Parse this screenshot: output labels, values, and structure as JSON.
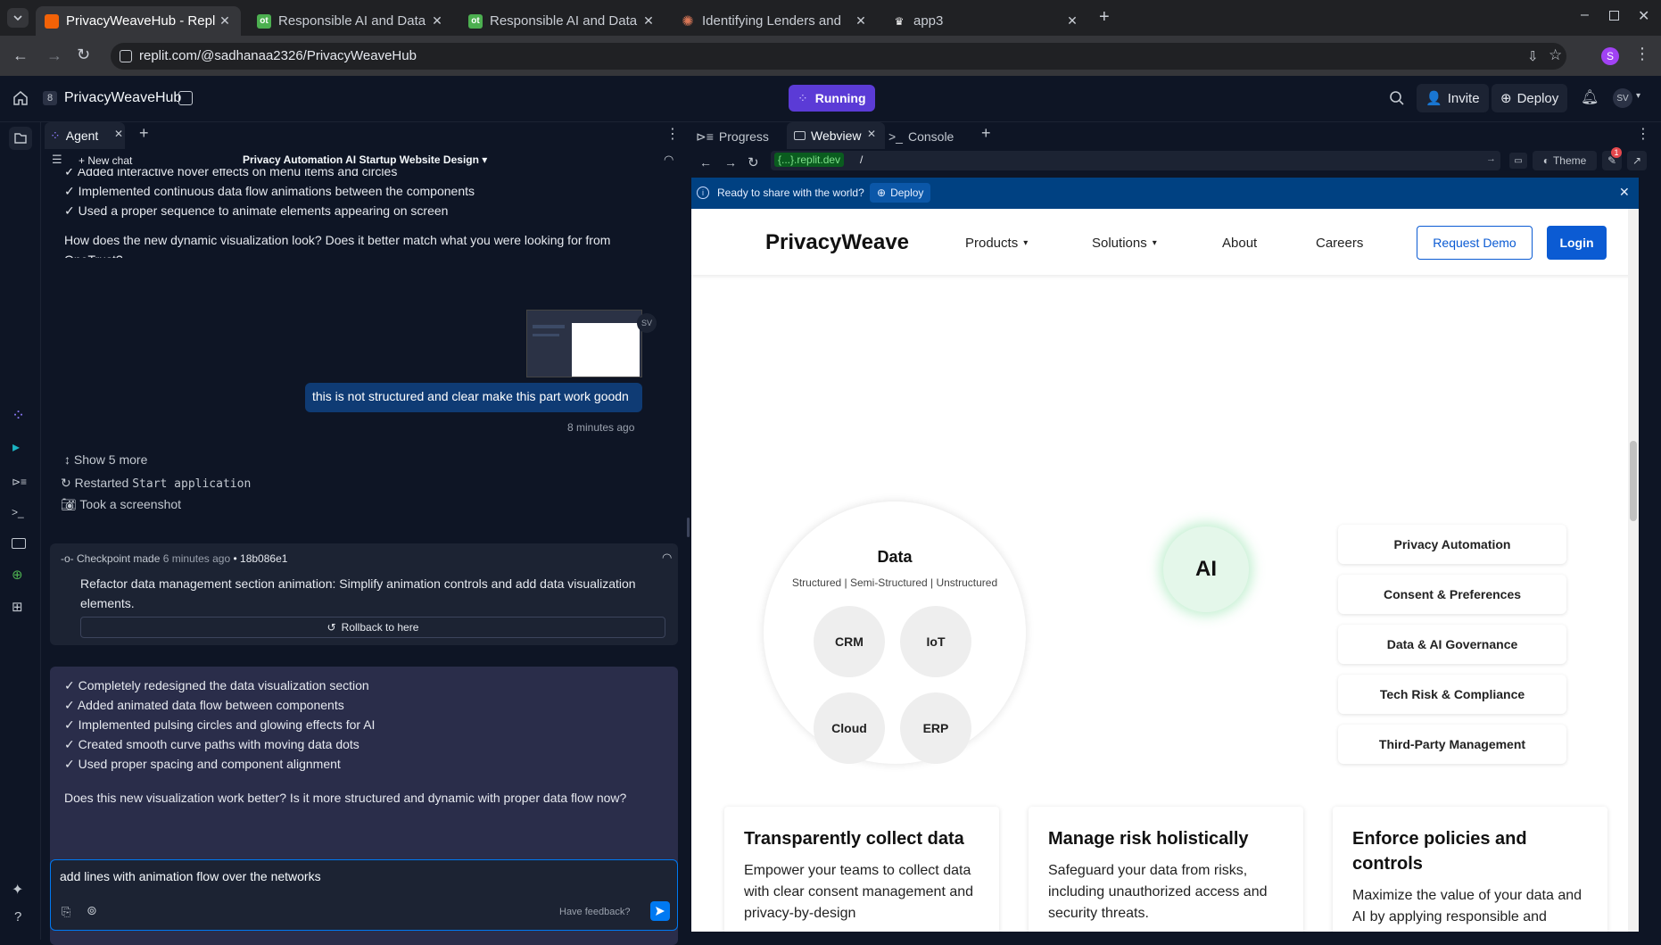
{
  "browser": {
    "tabs": [
      {
        "title": "PrivacyWeaveHub - Repl",
        "fav": "replit",
        "active": true
      },
      {
        "title": "Responsible AI and Data",
        "fav": "ot"
      },
      {
        "title": "Responsible AI and Data",
        "fav": "ot"
      },
      {
        "title": "Identifying Lenders and",
        "fav": "claude"
      },
      {
        "title": "app3",
        "fav": "crown"
      }
    ],
    "url": "replit.com/@sadhanaa2326/PrivacyWeaveHub",
    "profile_initial": "S"
  },
  "header": {
    "repl_number": "8",
    "repl_name": "PrivacyWeaveHub",
    "run_status": "Running",
    "invite": "Invite",
    "deploy": "Deploy",
    "avatar": "SV"
  },
  "agent": {
    "tab_label": "Agent",
    "new_chat": "New chat",
    "chat_title": "Privacy Automation AI Startup Website Design",
    "prev_items": [
      "✓ Added interactive hover effects on menu items and circles",
      "✓ Implemented continuous data flow animations between the components",
      "✓ Used a proper sequence to animate elements appearing on screen"
    ],
    "prev_question": "How does the new dynamic visualization look? Does it better match what you were looking for from OneTrust?",
    "user_initials": "SV",
    "user_message": "this is not structured and clear make this part work goodn",
    "user_time": "8 minutes ago",
    "show_more": "Show 5 more",
    "restarted_prefix": "Restarted ",
    "restarted_code": "Start application",
    "screenshot": "Took a screenshot",
    "checkpoint_label": "Checkpoint made",
    "checkpoint_time": "6 minutes ago",
    "checkpoint_hash": "• 18b086e1",
    "checkpoint_desc": "Refactor data management section animation: Simplify animation controls and add data visualization elements.",
    "rollback": "Rollback to here",
    "summary_items": [
      "✓ Completely redesigned the data visualization section",
      "✓ Added animated data flow between components",
      "✓ Implemented pulsing circles and glowing effects for AI",
      "✓ Created smooth curve paths with moving data dots",
      "✓ Used proper spacing and component alignment"
    ],
    "summary_question": "Does this new visualization work better? Is it more structured and dynamic with proper data flow now?",
    "input_value": "add lines with animation flow over the networks",
    "feedback": "Have feedback?"
  },
  "panes": {
    "tabs": [
      "Progress",
      "Webview",
      "Console"
    ],
    "web_url_host": "{...}.replit.dev",
    "web_url_path": "/",
    "theme": "Theme",
    "badge": "1",
    "banner_text": "Ready to share with the world?",
    "banner_deploy": "Deploy"
  },
  "site": {
    "logo": "PrivacyWeave",
    "nav": [
      "Products",
      "Solutions",
      "About",
      "Careers"
    ],
    "request_demo": "Request Demo",
    "login": "Login",
    "data_title": "Data",
    "data_subtitle": "Structured | Semi-Structured | Unstructured",
    "nodes": [
      "CRM",
      "IoT",
      "Cloud",
      "ERP"
    ],
    "ai": "AI",
    "services": [
      "Privacy Automation",
      "Consent & Preferences",
      "Data & AI Governance",
      "Tech Risk & Compliance",
      "Third-Party Management"
    ],
    "cards": [
      {
        "title": "Transparently collect data",
        "text": "Empower your teams to collect data with clear consent management and privacy-by-design"
      },
      {
        "title": "Manage risk holistically",
        "text": "Safeguard your data from risks, including unauthorized access and security threats."
      },
      {
        "title": "Enforce policies and controls",
        "text": "Maximize the value of your data and AI by applying responsible and"
      }
    ]
  }
}
